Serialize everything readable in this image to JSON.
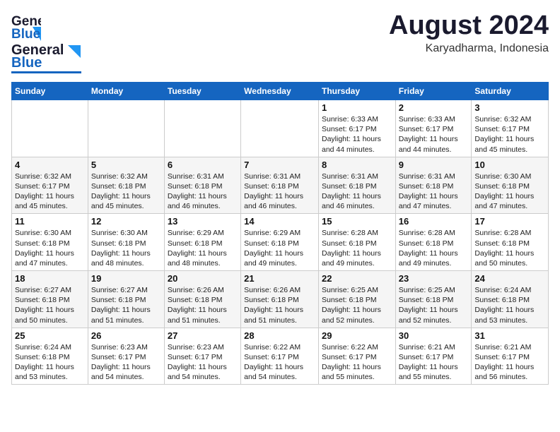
{
  "header": {
    "logo_general": "General",
    "logo_blue": "Blue",
    "month": "August 2024",
    "location": "Karyadharma, Indonesia"
  },
  "weekdays": [
    "Sunday",
    "Monday",
    "Tuesday",
    "Wednesday",
    "Thursday",
    "Friday",
    "Saturday"
  ],
  "weeks": [
    [
      {
        "day": "",
        "detail": ""
      },
      {
        "day": "",
        "detail": ""
      },
      {
        "day": "",
        "detail": ""
      },
      {
        "day": "",
        "detail": ""
      },
      {
        "day": "1",
        "detail": "Sunrise: 6:33 AM\nSunset: 6:17 PM\nDaylight: 11 hours\nand 44 minutes."
      },
      {
        "day": "2",
        "detail": "Sunrise: 6:33 AM\nSunset: 6:17 PM\nDaylight: 11 hours\nand 44 minutes."
      },
      {
        "day": "3",
        "detail": "Sunrise: 6:32 AM\nSunset: 6:17 PM\nDaylight: 11 hours\nand 45 minutes."
      }
    ],
    [
      {
        "day": "4",
        "detail": "Sunrise: 6:32 AM\nSunset: 6:17 PM\nDaylight: 11 hours\nand 45 minutes."
      },
      {
        "day": "5",
        "detail": "Sunrise: 6:32 AM\nSunset: 6:18 PM\nDaylight: 11 hours\nand 45 minutes."
      },
      {
        "day": "6",
        "detail": "Sunrise: 6:31 AM\nSunset: 6:18 PM\nDaylight: 11 hours\nand 46 minutes."
      },
      {
        "day": "7",
        "detail": "Sunrise: 6:31 AM\nSunset: 6:18 PM\nDaylight: 11 hours\nand 46 minutes."
      },
      {
        "day": "8",
        "detail": "Sunrise: 6:31 AM\nSunset: 6:18 PM\nDaylight: 11 hours\nand 46 minutes."
      },
      {
        "day": "9",
        "detail": "Sunrise: 6:31 AM\nSunset: 6:18 PM\nDaylight: 11 hours\nand 47 minutes."
      },
      {
        "day": "10",
        "detail": "Sunrise: 6:30 AM\nSunset: 6:18 PM\nDaylight: 11 hours\nand 47 minutes."
      }
    ],
    [
      {
        "day": "11",
        "detail": "Sunrise: 6:30 AM\nSunset: 6:18 PM\nDaylight: 11 hours\nand 47 minutes."
      },
      {
        "day": "12",
        "detail": "Sunrise: 6:30 AM\nSunset: 6:18 PM\nDaylight: 11 hours\nand 48 minutes."
      },
      {
        "day": "13",
        "detail": "Sunrise: 6:29 AM\nSunset: 6:18 PM\nDaylight: 11 hours\nand 48 minutes."
      },
      {
        "day": "14",
        "detail": "Sunrise: 6:29 AM\nSunset: 6:18 PM\nDaylight: 11 hours\nand 49 minutes."
      },
      {
        "day": "15",
        "detail": "Sunrise: 6:28 AM\nSunset: 6:18 PM\nDaylight: 11 hours\nand 49 minutes."
      },
      {
        "day": "16",
        "detail": "Sunrise: 6:28 AM\nSunset: 6:18 PM\nDaylight: 11 hours\nand 49 minutes."
      },
      {
        "day": "17",
        "detail": "Sunrise: 6:28 AM\nSunset: 6:18 PM\nDaylight: 11 hours\nand 50 minutes."
      }
    ],
    [
      {
        "day": "18",
        "detail": "Sunrise: 6:27 AM\nSunset: 6:18 PM\nDaylight: 11 hours\nand 50 minutes."
      },
      {
        "day": "19",
        "detail": "Sunrise: 6:27 AM\nSunset: 6:18 PM\nDaylight: 11 hours\nand 51 minutes."
      },
      {
        "day": "20",
        "detail": "Sunrise: 6:26 AM\nSunset: 6:18 PM\nDaylight: 11 hours\nand 51 minutes."
      },
      {
        "day": "21",
        "detail": "Sunrise: 6:26 AM\nSunset: 6:18 PM\nDaylight: 11 hours\nand 51 minutes."
      },
      {
        "day": "22",
        "detail": "Sunrise: 6:25 AM\nSunset: 6:18 PM\nDaylight: 11 hours\nand 52 minutes."
      },
      {
        "day": "23",
        "detail": "Sunrise: 6:25 AM\nSunset: 6:18 PM\nDaylight: 11 hours\nand 52 minutes."
      },
      {
        "day": "24",
        "detail": "Sunrise: 6:24 AM\nSunset: 6:18 PM\nDaylight: 11 hours\nand 53 minutes."
      }
    ],
    [
      {
        "day": "25",
        "detail": "Sunrise: 6:24 AM\nSunset: 6:18 PM\nDaylight: 11 hours\nand 53 minutes."
      },
      {
        "day": "26",
        "detail": "Sunrise: 6:23 AM\nSunset: 6:17 PM\nDaylight: 11 hours\nand 54 minutes."
      },
      {
        "day": "27",
        "detail": "Sunrise: 6:23 AM\nSunset: 6:17 PM\nDaylight: 11 hours\nand 54 minutes."
      },
      {
        "day": "28",
        "detail": "Sunrise: 6:22 AM\nSunset: 6:17 PM\nDaylight: 11 hours\nand 54 minutes."
      },
      {
        "day": "29",
        "detail": "Sunrise: 6:22 AM\nSunset: 6:17 PM\nDaylight: 11 hours\nand 55 minutes."
      },
      {
        "day": "30",
        "detail": "Sunrise: 6:21 AM\nSunset: 6:17 PM\nDaylight: 11 hours\nand 55 minutes."
      },
      {
        "day": "31",
        "detail": "Sunrise: 6:21 AM\nSunset: 6:17 PM\nDaylight: 11 hours\nand 56 minutes."
      }
    ]
  ]
}
